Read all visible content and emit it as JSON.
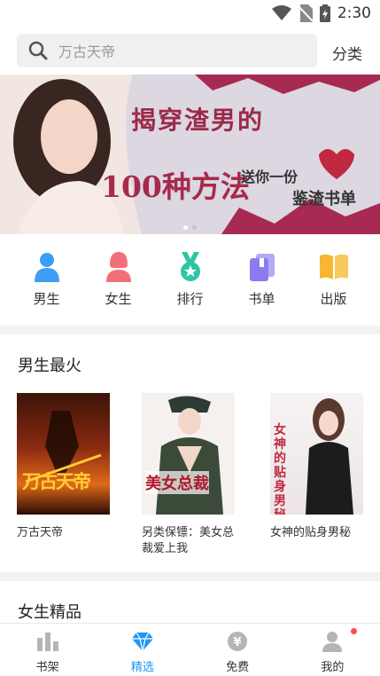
{
  "status_bar": {
    "time": "2:30",
    "icons": [
      "wifi-icon",
      "no-sim-icon",
      "battery-charging-icon"
    ]
  },
  "search": {
    "placeholder": "万古天帝",
    "category_label": "分类"
  },
  "banner": {
    "line1": "揭穿渣男的",
    "line2": "100种方法",
    "line3": "送你一份",
    "line4": "鉴渣书单",
    "active_dot_color": "#ffffff",
    "dot_color": "#c9c0ce"
  },
  "nav": {
    "items": [
      {
        "label": "男生",
        "icon": "male-icon",
        "color": "#3d9ef5"
      },
      {
        "label": "女生",
        "icon": "female-icon",
        "color": "#f0707a"
      },
      {
        "label": "排行",
        "icon": "ranking-medal-icon",
        "color": "#2fc4a5"
      },
      {
        "label": "书单",
        "icon": "booklist-icon",
        "color": "#8a7cf0"
      },
      {
        "label": "出版",
        "icon": "published-book-icon",
        "color": "#f7b733"
      }
    ]
  },
  "male_hot": {
    "title": "男生最火",
    "books": [
      {
        "title": "万古天帝",
        "cover_text": "万古天帝"
      },
      {
        "title": "另类保镖：美女总裁爱上我",
        "cover_text": "美女总裁"
      },
      {
        "title": "女神的贴身男秘",
        "cover_text": "女神的贴身男秘"
      }
    ]
  },
  "female_pick": {
    "title": "女生精品"
  },
  "tabs": [
    {
      "label": "书架",
      "icon": "bookshelf-icon",
      "active": false
    },
    {
      "label": "精选",
      "icon": "diamond-icon",
      "active": true
    },
    {
      "label": "免费",
      "icon": "yuan-coin-icon",
      "active": false
    },
    {
      "label": "我的",
      "icon": "profile-icon",
      "active": false,
      "badge": true
    }
  ],
  "colors": {
    "accent": "#2196f3",
    "badge": "#ff4d4f"
  }
}
